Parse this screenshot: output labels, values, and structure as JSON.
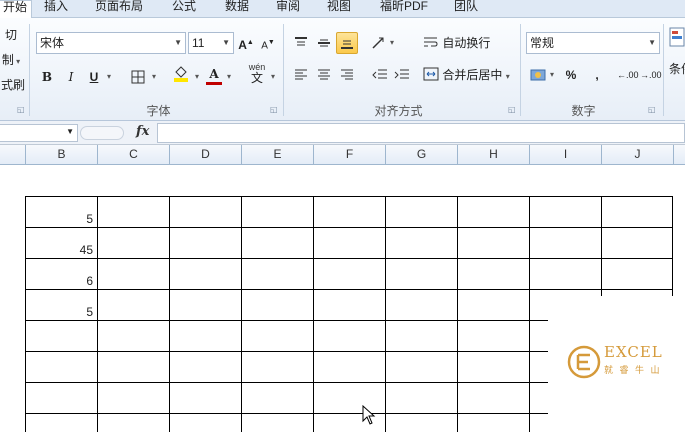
{
  "tabs": [
    "开始",
    "插入",
    "页面布局",
    "公式",
    "数据",
    "审阅",
    "视图",
    "福昕PDF",
    "团队"
  ],
  "clipboard": {
    "cut": "切",
    "copy": "制",
    "format_painter": "式刷"
  },
  "font": {
    "name": "宋体",
    "size": "11",
    "grow": "A",
    "shrink": "A",
    "bold": "B",
    "italic": "I",
    "underline": "U",
    "font_color_label": "A",
    "wen": "wén",
    "wen_char": "文",
    "group_label": "字体"
  },
  "alignment": {
    "wrap_text": "自动换行",
    "merge_center": "合并后居中",
    "group_label": "对齐方式"
  },
  "number": {
    "format": "常规",
    "percent": "%",
    "comma": ",",
    "inc_decimal": ".00",
    "dec_decimal": ".00",
    "group_label": "数字"
  },
  "styles": {
    "cond_format": "条件"
  },
  "formula_bar": {
    "fx": "fx",
    "name_value": "",
    "formula_value": ""
  },
  "columns": [
    "B",
    "C",
    "D",
    "E",
    "F",
    "G",
    "H",
    "I",
    "J"
  ],
  "cells": {
    "b_values": [
      "5",
      "45",
      "6",
      "5"
    ]
  },
  "watermark": {
    "text": "EXCEL",
    "sub": "就 睿 牛 山"
  },
  "colors": {
    "accent": "#fbc94b",
    "grid": "#000000",
    "header": "#e4ecf7"
  }
}
